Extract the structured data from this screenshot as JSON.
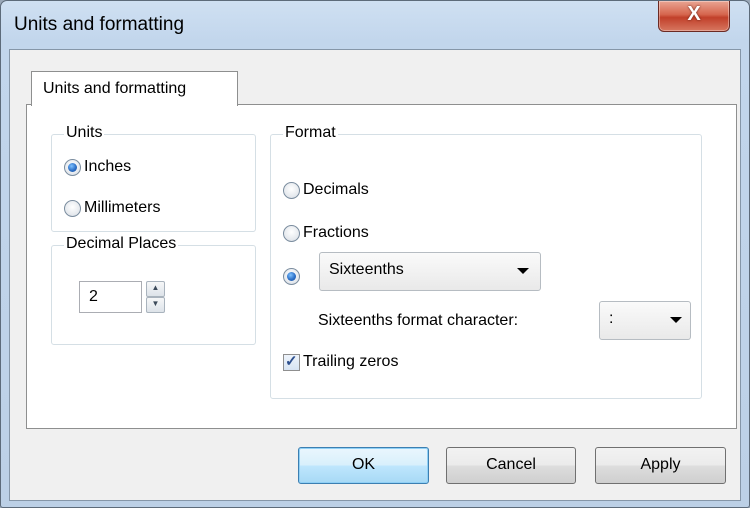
{
  "window": {
    "title": "Units and formatting",
    "close_glyph": "X"
  },
  "tabs": [
    {
      "label": "Units and formatting",
      "selected": true
    }
  ],
  "units": {
    "legend": "Units",
    "options": [
      {
        "label": "Inches",
        "checked": true
      },
      {
        "label": "Millimeters",
        "checked": false
      }
    ]
  },
  "decimal_places": {
    "legend": "Decimal Places",
    "value": "2",
    "up_glyph": "▲",
    "down_glyph": "▼"
  },
  "format": {
    "legend": "Format",
    "options": [
      {
        "label": "Decimals",
        "checked": false
      },
      {
        "label": "Fractions",
        "checked": false
      },
      {
        "label": "",
        "checked": true
      }
    ],
    "fraction_select": {
      "value": "Sixteenths"
    },
    "format_char_label": "Sixteenths format character:",
    "format_char_select": {
      "value": ":"
    },
    "trailing_zeros": {
      "label": "Trailing zeros",
      "checked": true,
      "check_glyph": "✓"
    }
  },
  "buttons": {
    "ok": "OK",
    "cancel": "Cancel",
    "apply": "Apply"
  },
  "colors": {
    "accent": "#2c6fc7",
    "close": "#c1402a",
    "default_button": "#bee6fd"
  }
}
